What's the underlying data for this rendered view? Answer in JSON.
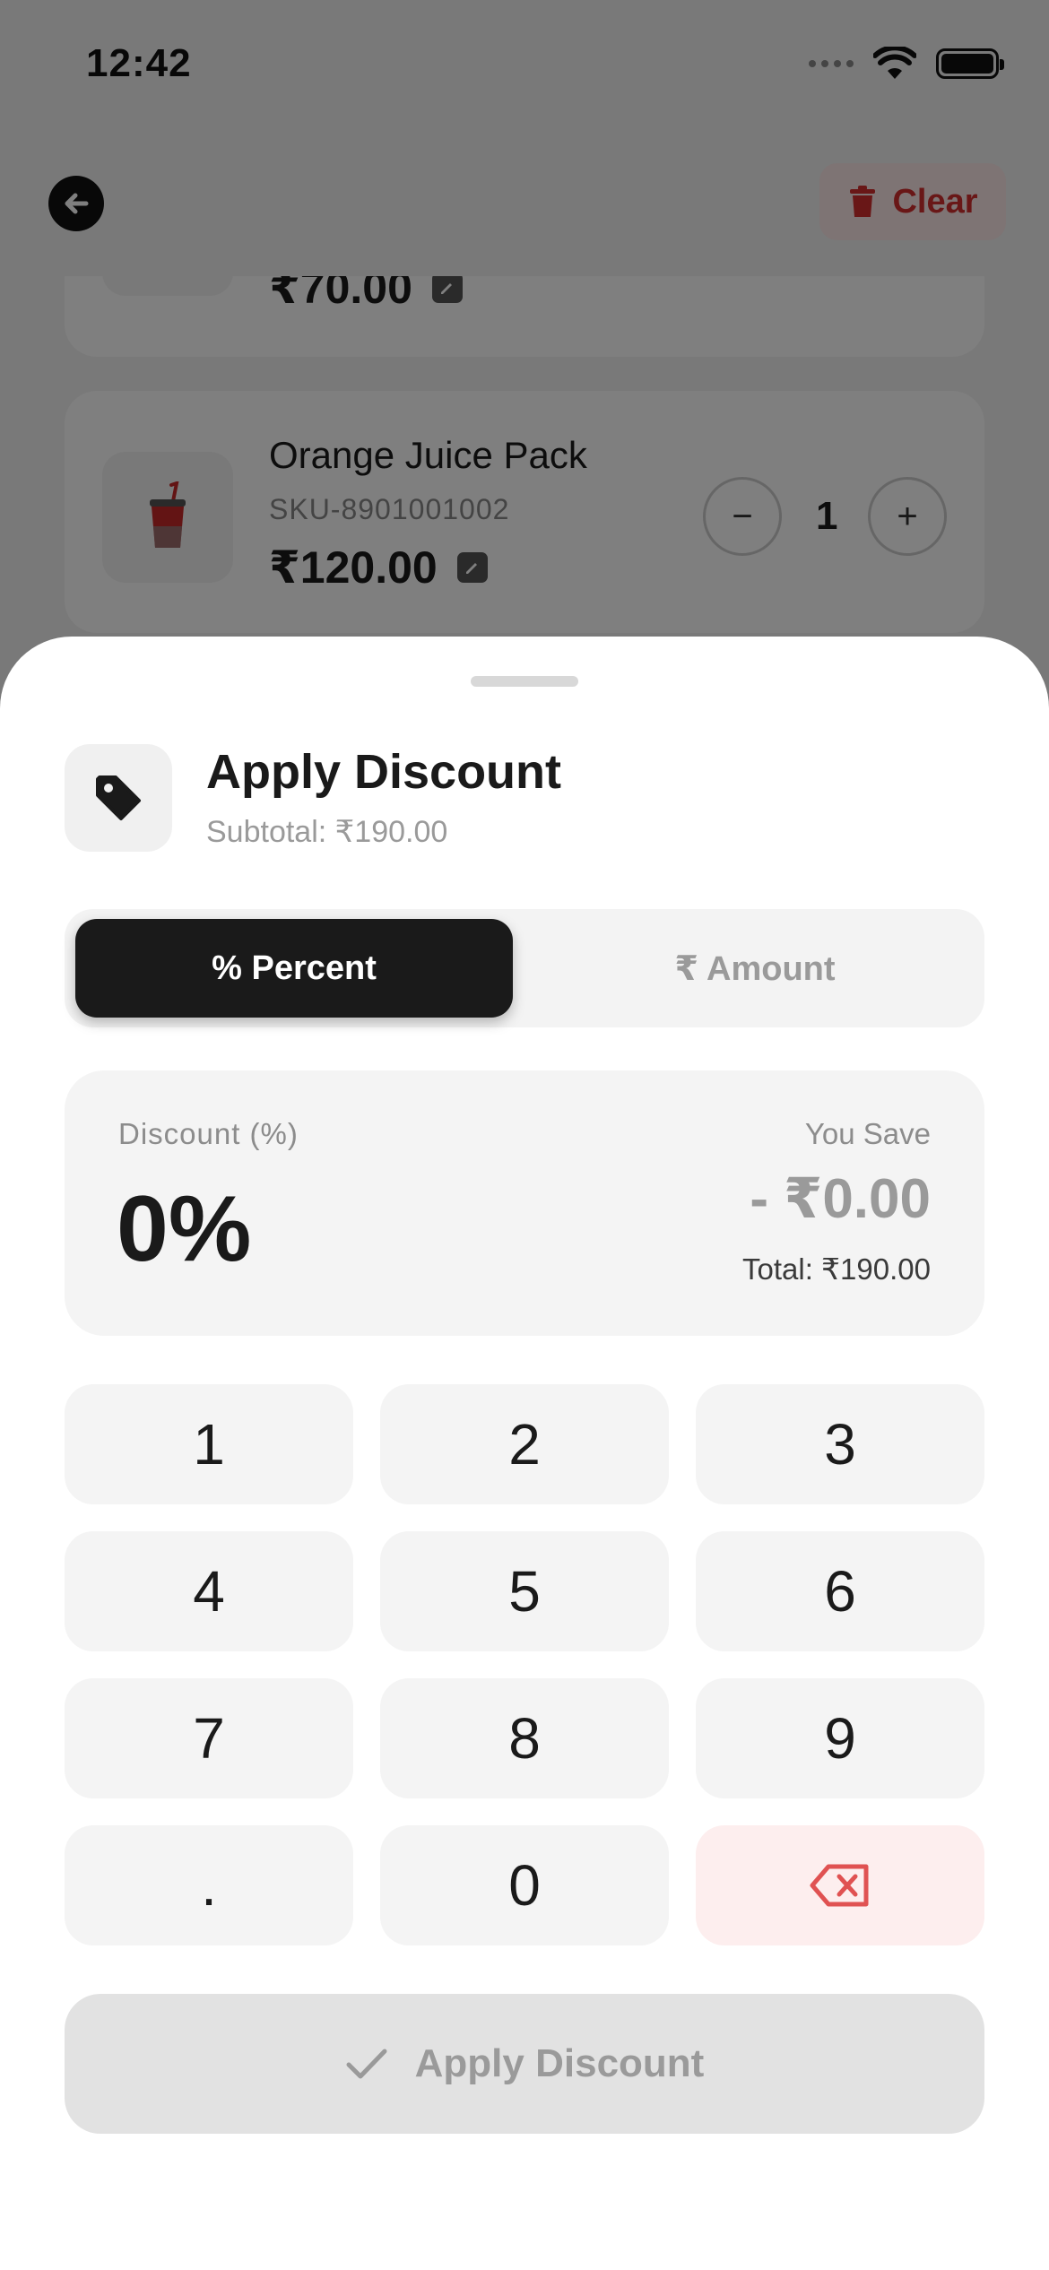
{
  "status_bar": {
    "time": "12:42"
  },
  "header": {
    "clear_label": "Clear"
  },
  "cart": {
    "items": [
      {
        "price": "₹70.00"
      },
      {
        "name": "Orange Juice Pack",
        "sku": "SKU-8901001002",
        "price": "₹120.00",
        "quantity": "1"
      }
    ]
  },
  "sheet": {
    "title": "Apply Discount",
    "subtitle": "Subtotal: ₹190.00",
    "mode": {
      "percent_label": "% Percent",
      "amount_label": "₹ Amount",
      "selected": "percent"
    },
    "display": {
      "label": "Discount (%)",
      "value": "0%",
      "save_label": "You Save",
      "save_value": "- ₹0.00",
      "total": "Total: ₹190.00"
    },
    "keypad": {
      "keys": [
        "1",
        "2",
        "3",
        "4",
        "5",
        "6",
        "7",
        "8",
        "9",
        ".",
        "0"
      ]
    },
    "apply_label": "Apply Discount"
  },
  "colors": {
    "accent_dark": "#1a1a1a",
    "danger": "#d32f2f",
    "danger_bg": "#fdeeee",
    "muted": "#9a9a9a"
  },
  "icons": {
    "back": "arrow-left-icon",
    "clear": "trash-icon",
    "edit": "pencil-icon",
    "sheet": "tag-icon",
    "delete_key": "backspace-icon",
    "apply": "check-icon"
  }
}
